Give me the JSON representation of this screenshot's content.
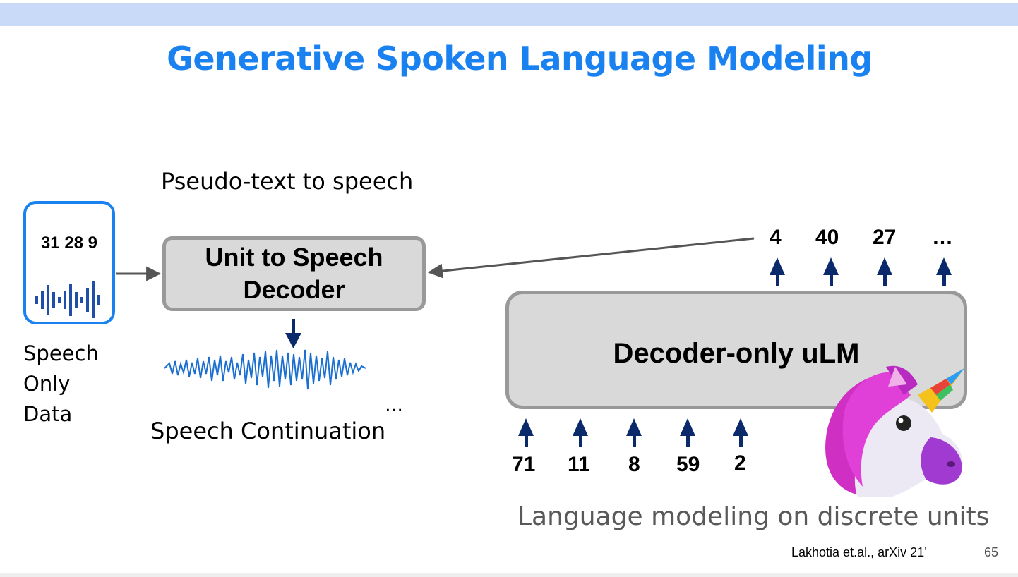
{
  "title": "Generative Spoken Language Modeling",
  "pseudo_text_label": "Pseudo-text to speech",
  "speech_box": {
    "units": "31 28 9"
  },
  "speech_only_data": [
    "Speech",
    "Only",
    "Data"
  ],
  "unit_to_speech": {
    "line1": "Unit to Speech",
    "line2": "Decoder"
  },
  "decoder_ulm": {
    "label": "Decoder-only uLM"
  },
  "output_units": [
    "4",
    "40",
    "27",
    "…"
  ],
  "input_units": [
    "71",
    "11",
    "8",
    "59",
    "2"
  ],
  "speech_continuation": "Speech Continuation",
  "continuation_ellipsis": "…",
  "lm_caption": "Language modeling on discrete units",
  "citation": "Lakhotia et.al., arXiv 21’",
  "page_number": "65",
  "colors": {
    "accent": "#1a82f0",
    "arrow": "#0b2a6b",
    "box_fill": "#d9d9d9",
    "box_border": "#999999"
  },
  "icons": [
    "waveform-icon",
    "unicorn-icon"
  ]
}
